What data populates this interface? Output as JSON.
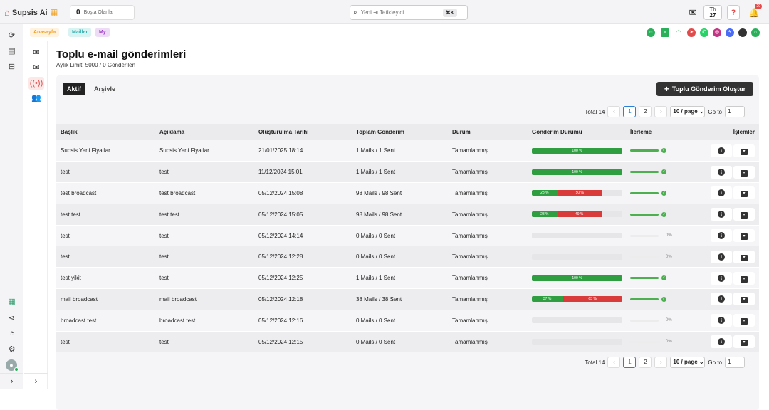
{
  "topbar": {
    "brand": "Supsis Ai",
    "idle_count": "0",
    "idle_label": "Boşta Olanlar",
    "search_placeholder": "Yeni ⇥ Tetikleyici",
    "search_shortcut": "⌘K",
    "lang_top": "Th",
    "lang_bottom": "27",
    "help": "?",
    "notif_count": "29"
  },
  "tabs": {
    "home": "Anasayfa",
    "mails": "Mailler",
    "my": "My"
  },
  "page": {
    "title": "Toplu e-mail gönderimleri",
    "subtitle": "Aylık Limit: 5000 / 0 Gönderilen"
  },
  "filters": {
    "active": "Aktif",
    "archive": "Arşivle",
    "create": "Toplu Gönderim Oluştur"
  },
  "pager": {
    "total": "Total 14",
    "prev": "‹",
    "next": "›",
    "pages": [
      "1",
      "2"
    ],
    "current": "1",
    "page_size": "10 / page",
    "goto_label": "Go to",
    "goto_value": "1"
  },
  "columns": [
    "Başlık",
    "Açıklama",
    "Oluşturulma Tarihi",
    "Toplam Gönderim",
    "Durum",
    "Gönderim Durumu",
    "İlerleme",
    "İşlemler"
  ],
  "rows": [
    {
      "title": "Supsis Yeni Fiyatlar",
      "desc": "Supsis Yeni Fiyatlar",
      "date": "21/01/2025 18:14",
      "total": "1 Mails / 1 Sent",
      "status": "Tamamlanmış",
      "green": 100,
      "green_label": "100 %",
      "red": 0,
      "red_label": "",
      "progress": 100,
      "pct": ""
    },
    {
      "title": "test",
      "desc": "test",
      "date": "11/12/2024 15:01",
      "total": "1 Mails / 1 Sent",
      "status": "Tamamlanmış",
      "green": 100,
      "green_label": "100 %",
      "red": 0,
      "red_label": "",
      "progress": 100,
      "pct": ""
    },
    {
      "title": "test broadcast",
      "desc": "test broadcast",
      "date": "05/12/2024 15:08",
      "total": "98 Mails / 98 Sent",
      "status": "Tamamlanmış",
      "green": 28,
      "green_label": "28 %",
      "red": 50,
      "red_label": "50 %",
      "progress": 100,
      "pct": ""
    },
    {
      "title": "test test",
      "desc": "test test",
      "date": "05/12/2024 15:05",
      "total": "98 Mails / 98 Sent",
      "status": "Tamamlanmış",
      "green": 28,
      "green_label": "28 %",
      "red": 49,
      "red_label": "49 %",
      "progress": 100,
      "pct": ""
    },
    {
      "title": "test",
      "desc": "test",
      "date": "05/12/2024 14:14",
      "total": "0 Mails / 0 Sent",
      "status": "Tamamlanmış",
      "green": 0,
      "green_label": "",
      "red": 0,
      "red_label": "",
      "progress": 0,
      "pct": "0%"
    },
    {
      "title": "test",
      "desc": "test",
      "date": "05/12/2024 12:28",
      "total": "0 Mails / 0 Sent",
      "status": "Tamamlanmış",
      "green": 0,
      "green_label": "",
      "red": 0,
      "red_label": "",
      "progress": 0,
      "pct": "0%"
    },
    {
      "title": "test yikit",
      "desc": "test",
      "date": "05/12/2024 12:25",
      "total": "1 Mails / 1 Sent",
      "status": "Tamamlanmış",
      "green": 100,
      "green_label": "100 %",
      "red": 0,
      "red_label": "",
      "progress": 100,
      "pct": ""
    },
    {
      "title": "mail broadcast",
      "desc": "mail broadcast",
      "date": "05/12/2024 12:18",
      "total": "38 Mails / 38 Sent",
      "status": "Tamamlanmış",
      "green": 34,
      "green_label": "37 %",
      "red": 66,
      "red_label": "63 %",
      "progress": 100,
      "pct": ""
    },
    {
      "title": "broadcast test",
      "desc": "broadcast test",
      "date": "05/12/2024 12:16",
      "total": "0 Mails / 0 Sent",
      "status": "Tamamlanmış",
      "green": 0,
      "green_label": "",
      "red": 0,
      "red_label": "",
      "progress": 0,
      "pct": "0%"
    },
    {
      "title": "test",
      "desc": "test",
      "date": "05/12/2024 12:15",
      "total": "0 Mails / 0 Sent",
      "status": "Tamamlanmış",
      "green": 0,
      "green_label": "",
      "red": 0,
      "red_label": "",
      "progress": 0,
      "pct": "0%"
    }
  ],
  "colors": {
    "green": "#2e9e41",
    "red": "#d93a3a",
    "brand": "#e14b4b"
  }
}
